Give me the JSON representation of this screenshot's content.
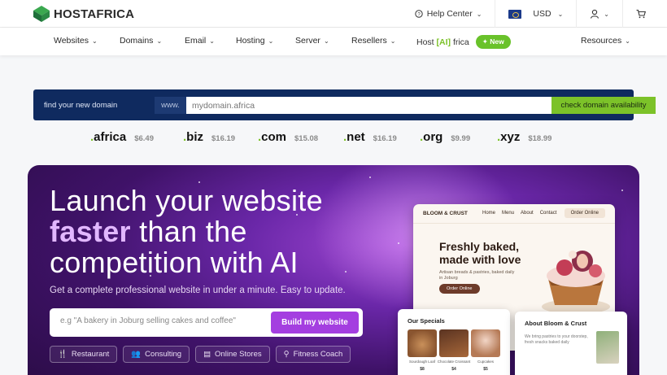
{
  "header": {
    "logo_text": "HOSTAFRICA",
    "help_label": "Help Center",
    "currency": "USD"
  },
  "nav": {
    "items": [
      "Websites",
      "Domains",
      "Email",
      "Hosting",
      "Server",
      "Resellers"
    ],
    "ai_prefix": "Host",
    "ai_mid": "[AI]",
    "ai_suffix": "frica",
    "new_badge": "New",
    "resources": "Resources"
  },
  "domain_search": {
    "label": "find your new domain",
    "prefix": "www.",
    "placeholder": "mydomain.africa",
    "button": "check domain availability"
  },
  "tlds": [
    {
      "name": "africa",
      "price": "$6.49"
    },
    {
      "name": "biz",
      "price": "$16.19"
    },
    {
      "name": "com",
      "price": "$15.08"
    },
    {
      "name": "net",
      "price": "$16.19"
    },
    {
      "name": "org",
      "price": "$9.99"
    },
    {
      "name": "xyz",
      "price": "$18.99"
    }
  ],
  "hero": {
    "line1": "Launch your website",
    "accent": "faster",
    "line2_rest": " than the",
    "line3": "competition with AI",
    "subtitle": "Get a complete professional website in under a minute. Easy to update.",
    "prompt_placeholder": "e.g \"A bakery in Joburg selling cakes and coffee\"",
    "build_button": "Build my website",
    "chips": [
      "Restaurant",
      "Consulting",
      "Online Stores",
      "Fitness Coach"
    ]
  },
  "preview": {
    "brand": "BLOOM & CRUST",
    "links": [
      "Home",
      "Menu",
      "About",
      "Contact"
    ],
    "order": "Order Online",
    "headline": "Freshly baked, made with love",
    "tagline": "Artisan breads & pastries, baked daily in Joburg",
    "cta": "Order Online",
    "specials_title": "Our Specials",
    "specials": [
      {
        "label": "Sourdough Loaf",
        "price": "$8"
      },
      {
        "label": "Chocolate Croissant",
        "price": "$4"
      },
      {
        "label": "Cupcakes",
        "price": "$5"
      }
    ],
    "about_title": "About Bloom & Crust",
    "about_text": "We bring pastries to your doorstep, fresh snacks baked daily"
  },
  "colors": {
    "brand_green": "#7cc229",
    "domain_bar": "#0f2a5f",
    "hero_purple": "#6a27a8",
    "build_button": "#a43ee0"
  }
}
